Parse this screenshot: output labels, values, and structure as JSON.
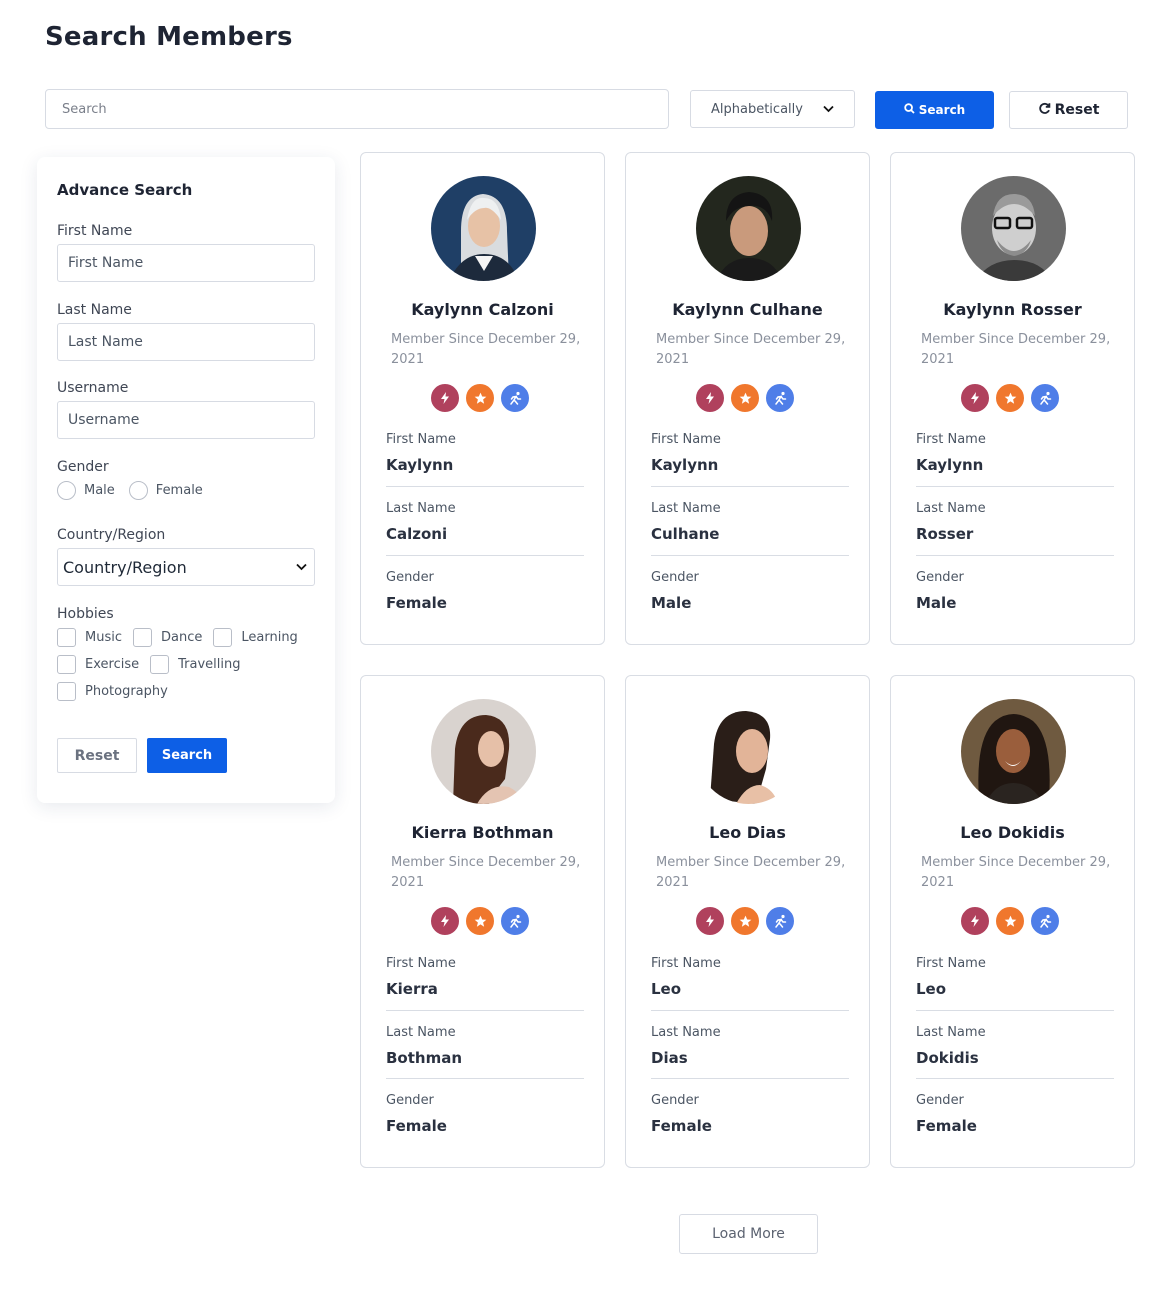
{
  "page": {
    "title": "Search Members"
  },
  "toolbar": {
    "search_placeholder": "Search",
    "sort_value": "Alphabetically",
    "search_label": "Search",
    "reset_label": "Reset"
  },
  "advance_search": {
    "title": "Advance Search",
    "first_name_label": "First Name",
    "first_name_placeholder": "First Name",
    "last_name_label": "Last Name",
    "last_name_placeholder": "Last Name",
    "username_label": "Username",
    "username_placeholder": "Username",
    "gender_label": "Gender",
    "gender_options": [
      "Male",
      "Female"
    ],
    "country_label": "Country/Region",
    "country_value": "Country/Region",
    "hobbies_label": "Hobbies",
    "hobbies": [
      "Music",
      "Dance",
      "Learning",
      "Exercise",
      "Travelling",
      "Photography"
    ],
    "reset_label": "Reset",
    "search_label": "Search"
  },
  "card_labels": {
    "first_name": "First Name",
    "last_name": "Last Name",
    "gender": "Gender"
  },
  "members": [
    {
      "name": "Kaylynn Calzoni",
      "since": "Member Since December 29, 2021",
      "first_name": "Kaylynn",
      "last_name": "Calzoni",
      "gender": "Female"
    },
    {
      "name": "Kaylynn Culhane",
      "since": "Member Since December 29, 2021",
      "first_name": "Kaylynn",
      "last_name": "Culhane",
      "gender": "Male"
    },
    {
      "name": "Kaylynn Rosser",
      "since": "Member Since December 29, 2021",
      "first_name": "Kaylynn",
      "last_name": "Rosser",
      "gender": "Male"
    },
    {
      "name": "Kierra Bothman",
      "since": "Member Since December 29, 2021",
      "first_name": "Kierra",
      "last_name": "Bothman",
      "gender": "Female"
    },
    {
      "name": "Leo Dias",
      "since": "Member Since December 29, 2021",
      "first_name": "Leo",
      "last_name": "Dias",
      "gender": "Female"
    },
    {
      "name": "Leo Dokidis",
      "since": "Member Since December 29, 2021",
      "first_name": "Leo",
      "last_name": "Dokidis",
      "gender": "Female"
    }
  ],
  "badge_icons": [
    "bolt-icon",
    "star-icon",
    "runner-icon"
  ],
  "colors": {
    "primary": "#0d5fe6",
    "badge_bolt": "#b0415d",
    "badge_star": "#f0772d",
    "badge_runner": "#4f7ee8"
  },
  "load_more_label": "Load More"
}
